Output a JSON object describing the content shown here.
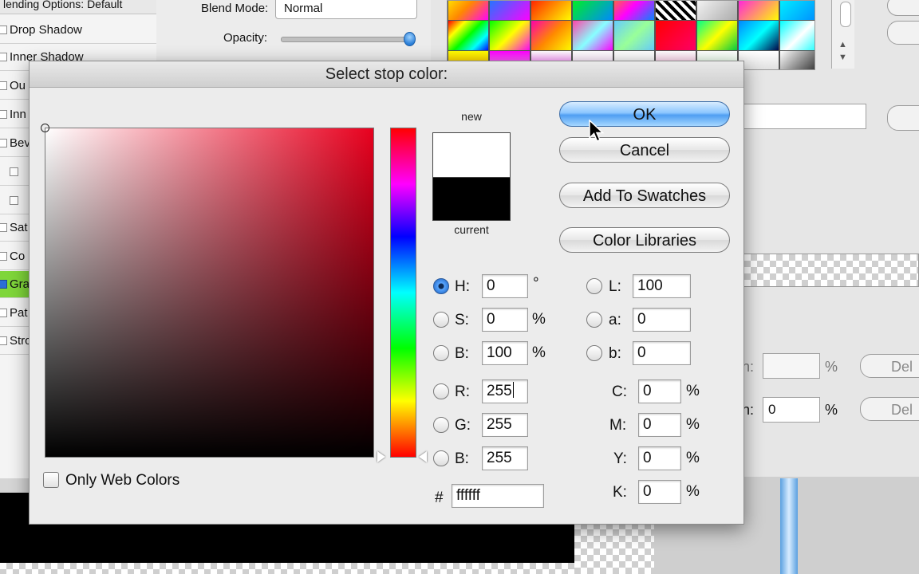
{
  "background": {
    "layer_style_title": "lending Options: Default",
    "effects": [
      {
        "label": "Drop Shadow",
        "active": false
      },
      {
        "label": "Inner Shadow",
        "active": false
      },
      {
        "label": "Ou",
        "active": false
      },
      {
        "label": "Inn",
        "active": false
      },
      {
        "label": "Bev",
        "active": false
      },
      {
        "label": "",
        "active": false
      },
      {
        "label": "",
        "active": false
      },
      {
        "label": "Sat",
        "active": false
      },
      {
        "label": "Co",
        "active": false
      },
      {
        "label": "Gra",
        "active": true
      },
      {
        "label": "Pat",
        "active": false
      },
      {
        "label": "Stro",
        "active": false
      }
    ],
    "blend_mode_label": "Blend Mode:",
    "blend_mode_value": "Normal",
    "opacity_label": "Opacity:",
    "location_suffix_1": "n:",
    "location_suffix_2": "n:",
    "location_value_2": "0",
    "percent_1": "%",
    "percent_2": "%",
    "delete_1": "Del",
    "delete_2": "Del"
  },
  "dialog": {
    "title": "Select stop color:",
    "new_label": "new",
    "current_label": "current",
    "new_color": "#ffffff",
    "current_color": "#000000",
    "buttons": {
      "ok": "OK",
      "cancel": "Cancel",
      "add_to_swatches": "Add To Swatches",
      "color_libraries": "Color Libraries"
    },
    "hsb": {
      "h_label": "H:",
      "h_value": "0",
      "h_unit": "°",
      "s_label": "S:",
      "s_value": "0",
      "s_unit": "%",
      "b_label": "B:",
      "b_value": "100",
      "b_unit": "%"
    },
    "rgb": {
      "r_label": "R:",
      "r_value": "255",
      "g_label": "G:",
      "g_value": "255",
      "b_label": "B:",
      "b_value": "255"
    },
    "lab": {
      "l_label": "L:",
      "l_value": "100",
      "a_label": "a:",
      "a_value": "0",
      "b_label": "b:",
      "b_value": "0"
    },
    "cmyk": {
      "c_label": "C:",
      "c_value": "0",
      "m_label": "M:",
      "m_value": "0",
      "y_label": "Y:",
      "y_value": "0",
      "k_label": "K:",
      "k_value": "0",
      "unit": "%"
    },
    "hex_label": "#",
    "hex_value": "ffffff",
    "only_web_colors": "Only Web Colors",
    "selected_mode": "H",
    "icons": {
      "cursor": "arrow-pointer-icon"
    }
  }
}
